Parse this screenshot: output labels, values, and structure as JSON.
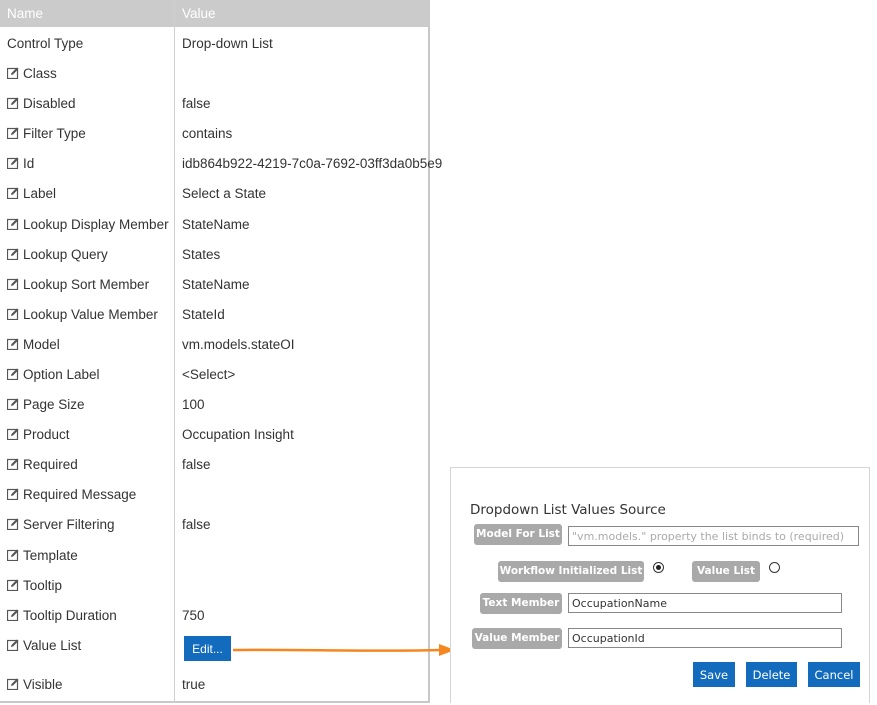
{
  "grid": {
    "header": {
      "name": "Name",
      "value": "Value"
    },
    "rows": [
      {
        "name": "Control Type",
        "value": "Drop-down List",
        "editable": false
      },
      {
        "name": "Class",
        "value": "",
        "editable": true
      },
      {
        "name": "Disabled",
        "value": "false",
        "editable": true
      },
      {
        "name": "Filter Type",
        "value": "contains",
        "editable": true
      },
      {
        "name": "Id",
        "value": "idb864b922-4219-7c0a-7692-03ff3da0b5e9",
        "editable": true
      },
      {
        "name": "Label",
        "value": "Select a State",
        "editable": true
      },
      {
        "name": "Lookup Display Member",
        "value": "StateName",
        "editable": true
      },
      {
        "name": "Lookup Query",
        "value": "States",
        "editable": true
      },
      {
        "name": "Lookup Sort Member",
        "value": "StateName",
        "editable": true
      },
      {
        "name": "Lookup Value Member",
        "value": "StateId",
        "editable": true
      },
      {
        "name": "Model",
        "value": "vm.models.stateOI",
        "editable": true
      },
      {
        "name": "Option Label",
        "value": "<Select>",
        "editable": true
      },
      {
        "name": "Page Size",
        "value": "100",
        "editable": true
      },
      {
        "name": "Product",
        "value": "Occupation Insight",
        "editable": true
      },
      {
        "name": "Required",
        "value": "false",
        "editable": true
      },
      {
        "name": "Required Message",
        "value": "",
        "editable": true
      },
      {
        "name": "Server Filtering",
        "value": "false",
        "editable": true
      },
      {
        "name": "Template",
        "value": "",
        "editable": true
      },
      {
        "name": "Tooltip",
        "value": "",
        "editable": true
      },
      {
        "name": "Tooltip Duration",
        "value": "750",
        "editable": true
      },
      {
        "name": "Value List",
        "value": "",
        "editable": true,
        "button": "Edit..."
      },
      {
        "name": "Visible",
        "value": "true",
        "editable": true
      }
    ],
    "icon": "edit-pencil-icon"
  },
  "dialog": {
    "title": "Dropdown List Values Source",
    "model_for_list": {
      "label": "Model For List",
      "value": "",
      "placeholder": "\"vm.models.\" property the list binds to (required)"
    },
    "source_options": [
      {
        "label": "Workflow Initialized List",
        "selected": true
      },
      {
        "label": "Value List",
        "selected": false
      }
    ],
    "text_member": {
      "label": "Text Member",
      "value": "OccupationName"
    },
    "value_member": {
      "label": "Value Member",
      "value": "OccupationId"
    },
    "buttons": {
      "save": "Save",
      "delete": "Delete",
      "cancel": "Cancel"
    }
  },
  "colors": {
    "accent": "#136bbd",
    "arrow": "#f7861e",
    "header": "#cbcbcb",
    "tag": "#a9a9a9"
  }
}
